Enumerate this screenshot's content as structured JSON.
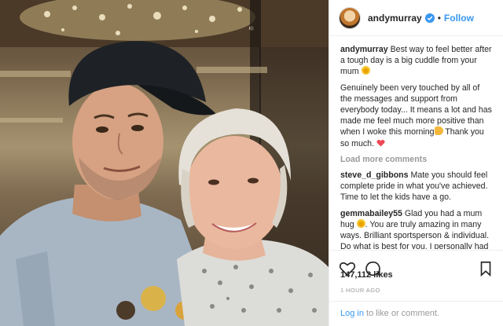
{
  "post": {
    "author": "andymurray",
    "follow_label": "Follow",
    "separator": "•",
    "caption": {
      "user": "andymurray",
      "text": "Best way to feel better after a tough day is a big cuddle from your mum",
      "text2": "Genuinely been very touched by all of the messages and support from everybody today... It means a lot and has made me feel much more positive than when I woke this morning",
      "text3": "Thank you so much."
    },
    "load_more": "Load more comments",
    "comments": [
      {
        "user": "steve_d_gibbons",
        "text": "Mate you should feel complete pride in what you've achieved. Time to let the kids have a go."
      },
      {
        "user": "gemmabailey55",
        "text": "Glad you had a mum hug",
        "text2": ". You are truly amazing in many ways. Brilliant sportsperson & individual. Do what is best for you. I personally had to grieve for my career when a back problem stopped me. Family support was incredible. Good luck with everything"
      }
    ],
    "likes": "147,112 likes",
    "time": "1 HOUR AGO",
    "login_link": "Log in",
    "login_rest": " to like or comment."
  },
  "icons": {
    "verified": "verified-badge-icon",
    "like": "heart-outline-icon",
    "comment": "speech-bubble-icon",
    "save": "bookmark-icon"
  },
  "colors": {
    "link_blue": "#3897f0",
    "verified_blue": "#3897f0",
    "muted_gray": "#999999",
    "heart_red": "#ed4956"
  }
}
